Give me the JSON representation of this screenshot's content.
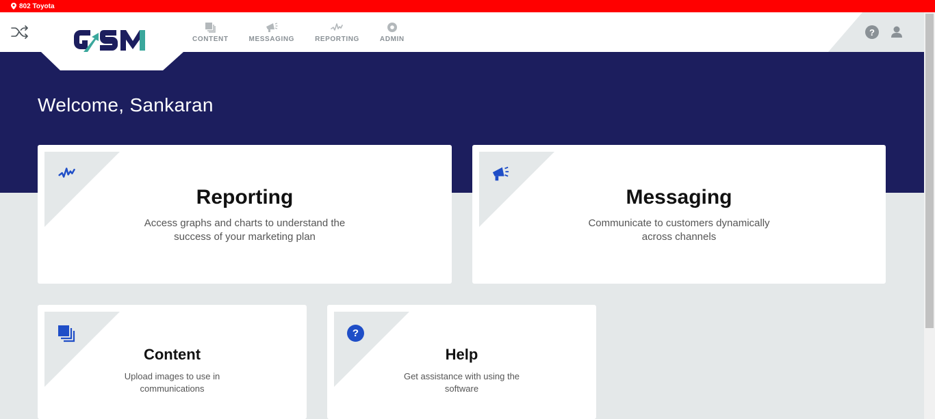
{
  "location_bar": {
    "label": "802 Toyota",
    "color": "#ff0000"
  },
  "brand": {
    "logo_text": "GSM",
    "primary": "#1c1e5e",
    "accent": "#3aa79c",
    "icon_blue": "#1f4ec7"
  },
  "nav": {
    "items": [
      {
        "label": "CONTENT",
        "icon": "stack-icon"
      },
      {
        "label": "MESSAGING",
        "icon": "megaphone-icon"
      },
      {
        "label": "REPORTING",
        "icon": "pulse-icon"
      },
      {
        "label": "ADMIN",
        "icon": "gear-icon"
      }
    ]
  },
  "header_actions": {
    "help": "?",
    "user_icon": "user-icon",
    "shuffle_icon": "shuffle-icon"
  },
  "welcome": "Welcome, Sankaran",
  "cards": [
    {
      "title": "Reporting",
      "description": "Access graphs and charts to understand the success of your marketing plan",
      "icon": "pulse-icon"
    },
    {
      "title": "Messaging",
      "description": "Communicate to customers dynamically across channels",
      "icon": "megaphone-icon"
    },
    {
      "title": "Content",
      "description": "Upload images to use in communications",
      "icon": "stack-icon"
    },
    {
      "title": "Help",
      "description": "Get assistance with using the software",
      "icon": "help-icon",
      "glyph": "?"
    }
  ]
}
